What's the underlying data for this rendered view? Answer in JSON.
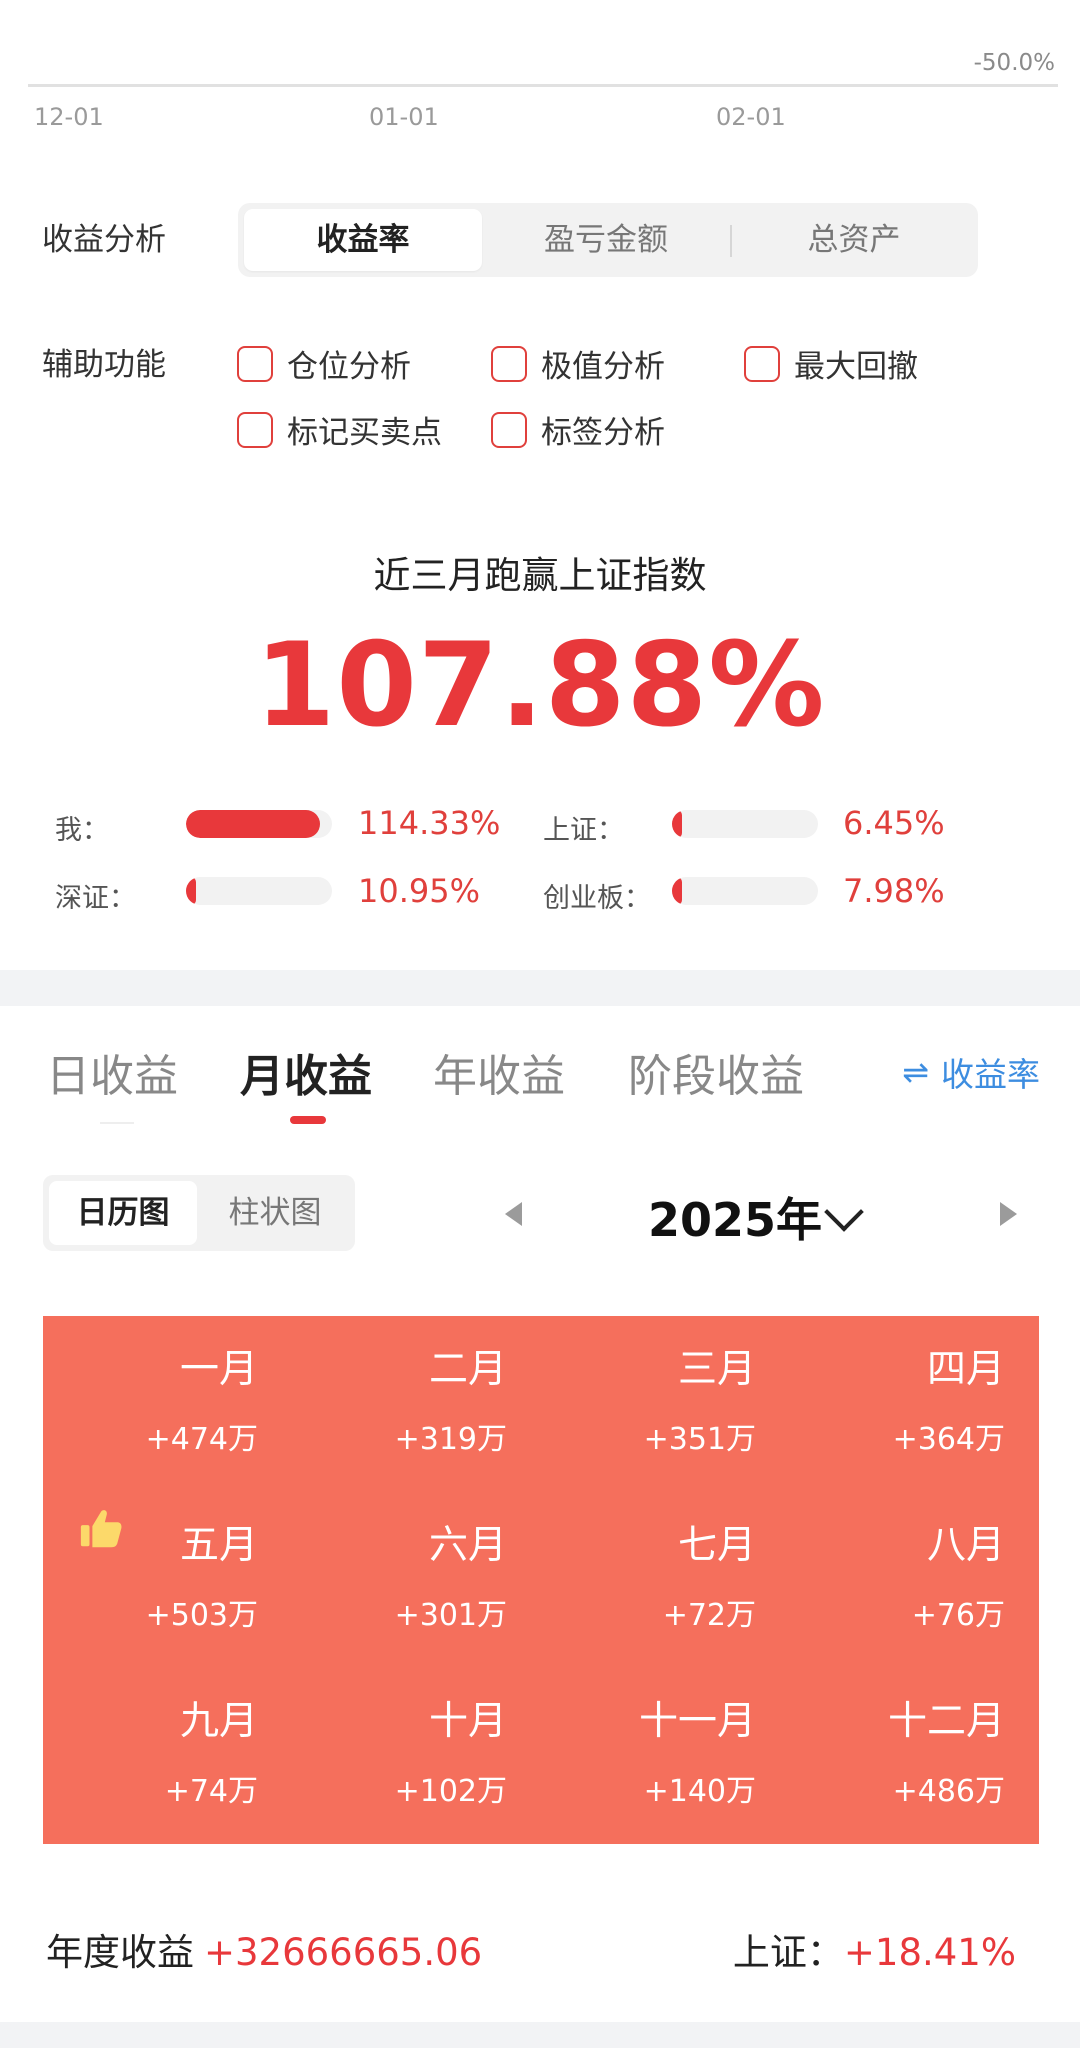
{
  "chart_axis": {
    "y_label": "-50.0%",
    "x_ticks": [
      "12-01",
      "01-01",
      "02-01"
    ]
  },
  "analysis": {
    "label": "收益分析",
    "options": [
      "收益率",
      "盈亏金额",
      "总资产"
    ],
    "selected": "收益率"
  },
  "aux": {
    "label": "辅助功能",
    "items": [
      "仓位分析",
      "极值分析",
      "最大回撤",
      "标记买卖点",
      "标签分析"
    ]
  },
  "beat": {
    "title": "近三月跑赢上证指数",
    "value": "107.88%"
  },
  "compare": [
    {
      "label": "我：",
      "value": "114.33%",
      "fill": 0.92
    },
    {
      "label": "上证：",
      "value": "6.45%",
      "fill": 0.07
    },
    {
      "label": "深证：",
      "value": "10.95%",
      "fill": 0.07
    },
    {
      "label": "创业板：",
      "value": "7.98%",
      "fill": 0.07
    }
  ],
  "colors": {
    "accent_red": "#e8383b",
    "calendar_bg": "#f56f5c",
    "link_blue": "#3d8de0"
  },
  "period_tabs": {
    "items": [
      "日收益",
      "月收益",
      "年收益",
      "阶段收益"
    ],
    "selected": "月收益",
    "switch_label": "收益率",
    "switch_icon": "swap-arrows-icon"
  },
  "view_toggle": {
    "items": [
      "日历图",
      "柱状图"
    ],
    "selected": "日历图"
  },
  "year": {
    "label": "2025年",
    "prev_icon": "triangle-left-icon",
    "next_icon": "triangle-right-icon"
  },
  "months": [
    {
      "name": "一月",
      "value": "+474万"
    },
    {
      "name": "二月",
      "value": "+319万"
    },
    {
      "name": "三月",
      "value": "+351万"
    },
    {
      "name": "四月",
      "value": "+364万"
    },
    {
      "name": "五月",
      "value": "+503万"
    },
    {
      "name": "六月",
      "value": "+301万"
    },
    {
      "name": "七月",
      "value": "+72万"
    },
    {
      "name": "八月",
      "value": "+76万"
    },
    {
      "name": "九月",
      "value": "+74万"
    },
    {
      "name": "十月",
      "value": "+102万"
    },
    {
      "name": "十一月",
      "value": "+140万"
    },
    {
      "name": "十二月",
      "value": "+486万"
    }
  ],
  "best_month_icon": "thumbs-up-icon",
  "footer": {
    "annual_label": "年度收益",
    "annual_value": "+32666665.06",
    "index_label": "上证：",
    "index_value": "+18.41%"
  }
}
